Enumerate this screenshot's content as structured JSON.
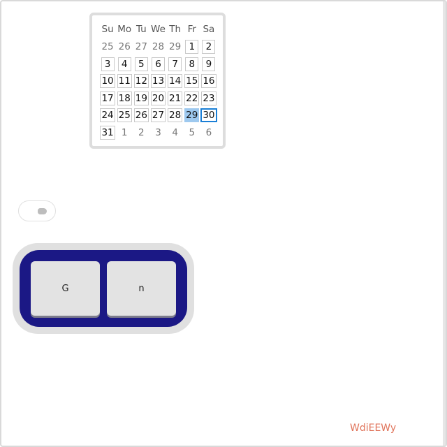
{
  "calendar": {
    "weekdays": [
      "Su",
      "Mo",
      "Tu",
      "We",
      "Th",
      "Fr",
      "Sa"
    ],
    "weeks": [
      [
        {
          "d": "25",
          "out": true
        },
        {
          "d": "26",
          "out": true
        },
        {
          "d": "27",
          "out": true
        },
        {
          "d": "28",
          "out": true
        },
        {
          "d": "29",
          "out": true
        },
        {
          "d": "1"
        },
        {
          "d": "2"
        }
      ],
      [
        {
          "d": "3"
        },
        {
          "d": "4"
        },
        {
          "d": "5"
        },
        {
          "d": "6"
        },
        {
          "d": "7"
        },
        {
          "d": "8"
        },
        {
          "d": "9"
        }
      ],
      [
        {
          "d": "10"
        },
        {
          "d": "11"
        },
        {
          "d": "12"
        },
        {
          "d": "13"
        },
        {
          "d": "14"
        },
        {
          "d": "15"
        },
        {
          "d": "16"
        }
      ],
      [
        {
          "d": "17"
        },
        {
          "d": "18"
        },
        {
          "d": "19"
        },
        {
          "d": "20"
        },
        {
          "d": "21"
        },
        {
          "d": "22"
        },
        {
          "d": "23"
        }
      ],
      [
        {
          "d": "24"
        },
        {
          "d": "25"
        },
        {
          "d": "26"
        },
        {
          "d": "27"
        },
        {
          "d": "28"
        },
        {
          "d": "29",
          "selected": true
        },
        {
          "d": "30",
          "focused": true
        }
      ],
      [
        {
          "d": "31"
        },
        {
          "d": "1",
          "out": true
        },
        {
          "d": "2",
          "out": true
        },
        {
          "d": "3",
          "out": true
        },
        {
          "d": "4",
          "out": true
        },
        {
          "d": "5",
          "out": true
        },
        {
          "d": "6",
          "out": true
        }
      ]
    ],
    "selected_color": "#9ec9ef",
    "focus_color": "#1a7fd6"
  },
  "toggle": {
    "on": false
  },
  "keys": {
    "key1": "G",
    "key2": "n",
    "frame_color": "#1b1885"
  },
  "corner_label": {
    "text": "WdiEEWy",
    "color": "#e0735a"
  }
}
